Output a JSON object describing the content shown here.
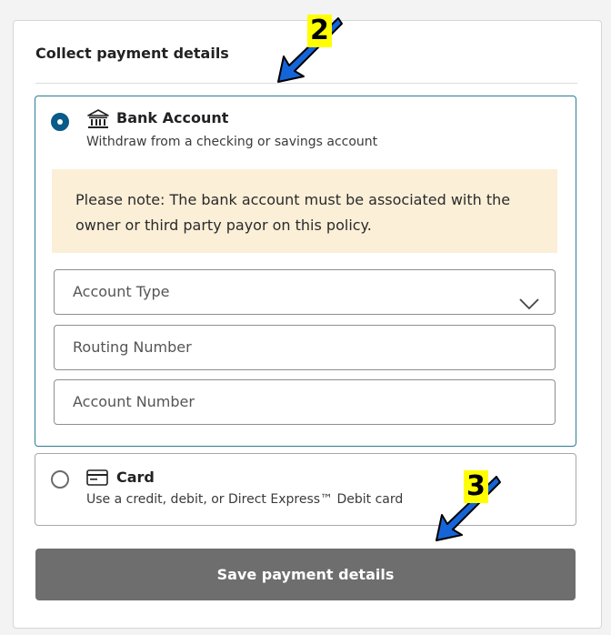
{
  "panel": {
    "title": "Collect payment details"
  },
  "bank_option": {
    "title": "Bank Account",
    "subtitle": "Withdraw from a checking or savings account",
    "icon": "bank-icon",
    "selected": true,
    "note": "Please note: The bank account must be associated with the owner or third party payor on this policy.",
    "fields": {
      "account_type_placeholder": "Account Type",
      "routing_placeholder": "Routing Number",
      "account_number_placeholder": "Account Number"
    }
  },
  "card_option": {
    "title": "Card",
    "subtitle": "Use a credit, debit, or Direct Express™ Debit card",
    "icon": "card-icon",
    "selected": false
  },
  "save_button": {
    "label": "Save payment details"
  },
  "annotations": {
    "step_2": "2",
    "step_3": "3"
  },
  "colors": {
    "selected_border": "#2c7d92",
    "radio_selected": "#0a5a8a",
    "note_background": "#fbefd8",
    "button_background": "#6e6e6e",
    "annotation_highlight": "#ffff00",
    "annotation_arrow": "#1565d8"
  }
}
